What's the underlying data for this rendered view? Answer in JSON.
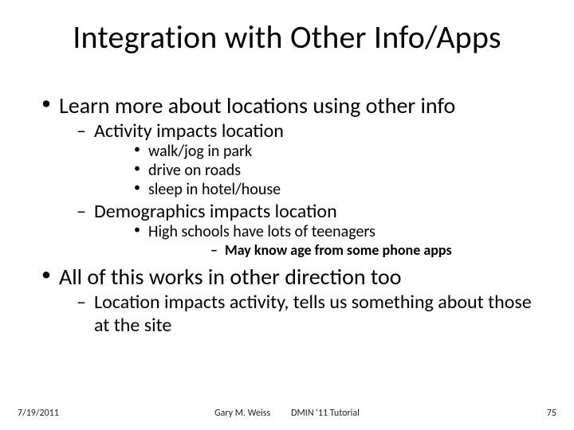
{
  "title": "Integration with Other Info/Apps",
  "bullets": {
    "b1": "Learn more about locations using other info",
    "b1_1": "Activity impacts location",
    "b1_1_1": "walk/jog in park",
    "b1_1_2": "drive on roads",
    "b1_1_3": "sleep in hotel/house",
    "b1_2": "Demographics impacts location",
    "b1_2_1": "High schools have lots of teenagers",
    "b1_2_1_1": "May know age from some phone apps",
    "b2": "All of this works in other direction too",
    "b2_1": "Location impacts activity, tells us something about those at the site"
  },
  "footer": {
    "date": "7/19/2011",
    "author": "Gary M. Weiss",
    "venue": "DMIN '11 Tutorial",
    "page": "75"
  }
}
